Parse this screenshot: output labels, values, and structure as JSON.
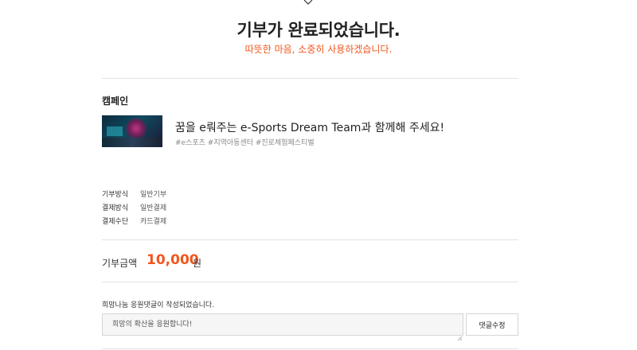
{
  "header": {
    "title": "기부가 완료되었습니다.",
    "subtitle": "따뜻한 마음, 소중히 사용하겠습니다."
  },
  "campaign": {
    "section_label": "캠페인",
    "title": "꿈을 e뤄주는 e-Sports Dream Team과 함께해 주세요!",
    "tags": "#e스포츠 #지역아동센터 #진로체험페스티벌"
  },
  "details": [
    {
      "label": "기부방식",
      "value": "일반기부"
    },
    {
      "label": "결제방식",
      "value": "일반결제"
    },
    {
      "label": "결제수단",
      "value": "카드결제"
    }
  ],
  "amount": {
    "label": "기부금액",
    "value": "10,000",
    "unit": "원"
  },
  "comment": {
    "note": "희망나눔 응원댓글이 작성되었습니다.",
    "value": "희망의 확산을 응원합니다!",
    "button_label": "댓글수정"
  },
  "colors": {
    "accent": "#f0561d",
    "divider": "#e2e2e2"
  }
}
